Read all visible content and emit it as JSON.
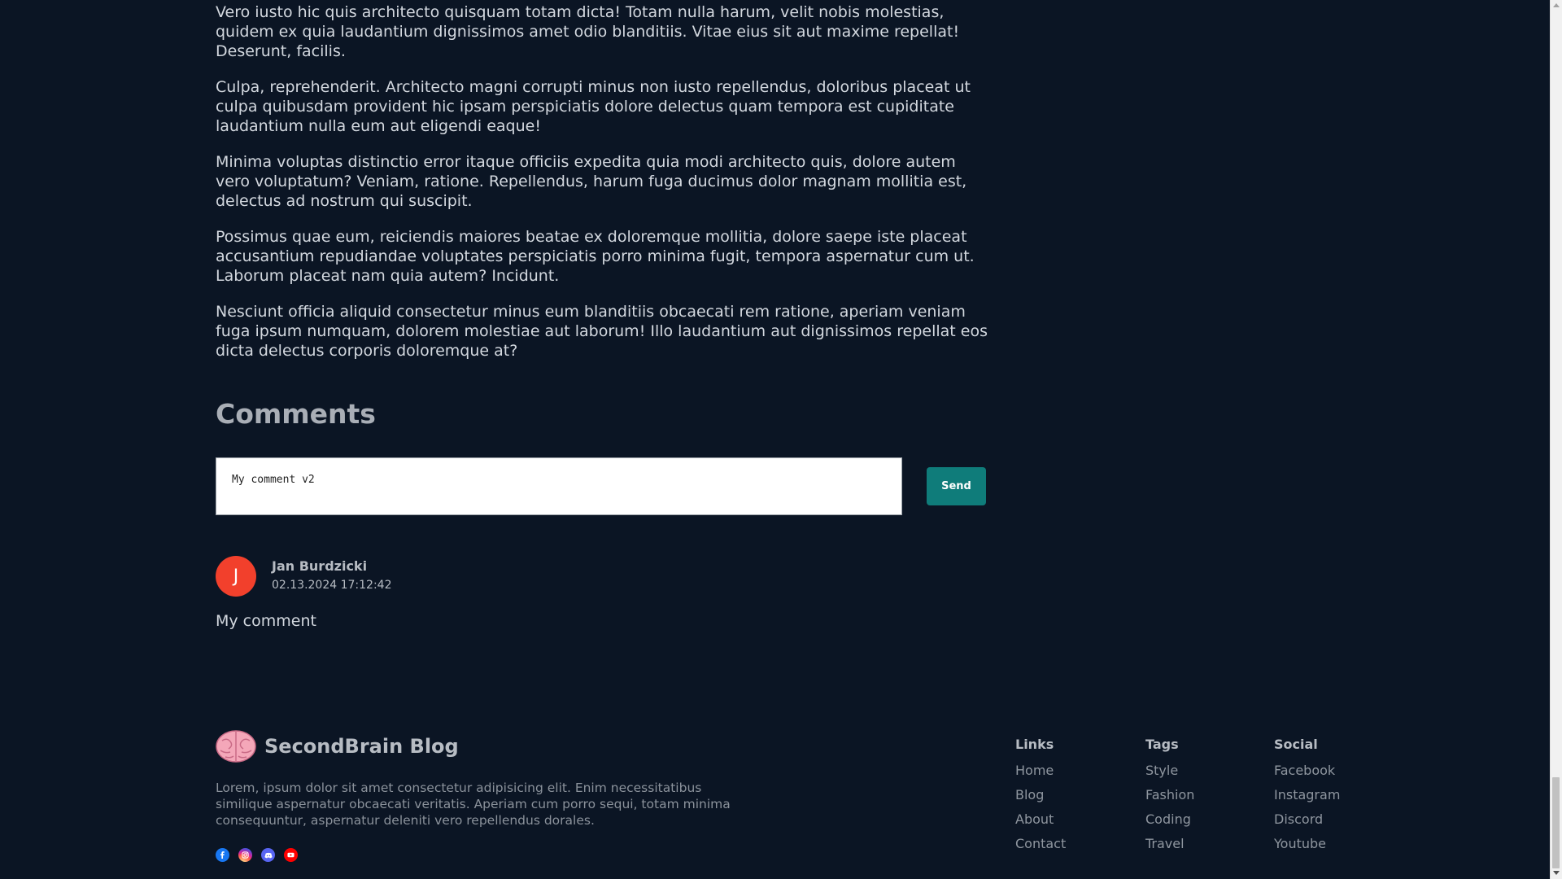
{
  "article": {
    "paragraphs": [
      "Vero iusto hic quis architecto quisquam totam dicta! Totam nulla harum, velit nobis molestias, quidem ex quia laudantium dignissimos amet odio blanditiis. Vitae eius sit aut maxime repellat! Deserunt, facilis.",
      "Culpa, reprehenderit. Architecto magni corrupti minus non iusto repellendus, doloribus placeat ut culpa quibusdam provident hic ipsam perspiciatis dolore delectus quam tempora est cupiditate laudantium nulla eum aut eligendi eaque!",
      "Minima voluptas distinctio error itaque officiis expedita quia modi architecto quis, dolore autem vero voluptatum? Veniam, ratione. Repellendus, harum fuga ducimus dolor magnam mollitia est, delectus ad nostrum qui suscipit.",
      "Possimus quae eum, reiciendis maiores beatae ex doloremque mollitia, dolore saepe iste placeat accusantium repudiandae voluptates perspiciatis porro minima fugit, tempora aspernatur cum ut. Laborum placeat nam quia autem? Incidunt.",
      "Nesciunt officia aliquid consectetur minus eum blanditiis obcaecati rem ratione, aperiam veniam fuga ipsum numquam, dolorem molestiae aut laborum! Illo laudantium aut dignissimos repellat eos dicta delectus corporis doloremque at?"
    ]
  },
  "comments": {
    "title": "Comments",
    "input_value": "My comment v2",
    "send_label": "Send",
    "items": [
      {
        "avatar_letter": "J",
        "author": "Jan Burdzicki",
        "date": "02.13.2024 17:12:42",
        "text": "My comment"
      }
    ]
  },
  "footer": {
    "brand_name": "SecondBrain Blog",
    "description": "Lorem, ipsum dolor sit amet consectetur adipisicing elit. Enim necessitatibus similique aspernatur obcaecati veritatis. Aperiam cum porro sequi, totam minima consequuntur, aspernatur deleniti vero repellendus dorales.",
    "social_icons": [
      "facebook-icon",
      "instagram-icon",
      "discord-icon",
      "youtube-icon"
    ],
    "columns": {
      "links": {
        "title": "Links",
        "items": [
          "Home",
          "Blog",
          "About",
          "Contact"
        ]
      },
      "tags": {
        "title": "Tags",
        "items": [
          "Style",
          "Fashion",
          "Coding",
          "Travel"
        ]
      },
      "social": {
        "title": "Social",
        "items": [
          "Facebook",
          "Instagram",
          "Discord",
          "Youtube"
        ]
      }
    }
  },
  "colors": {
    "background": "#0b1524",
    "accent": "#0f7c7a",
    "avatar": "#f2402c"
  }
}
